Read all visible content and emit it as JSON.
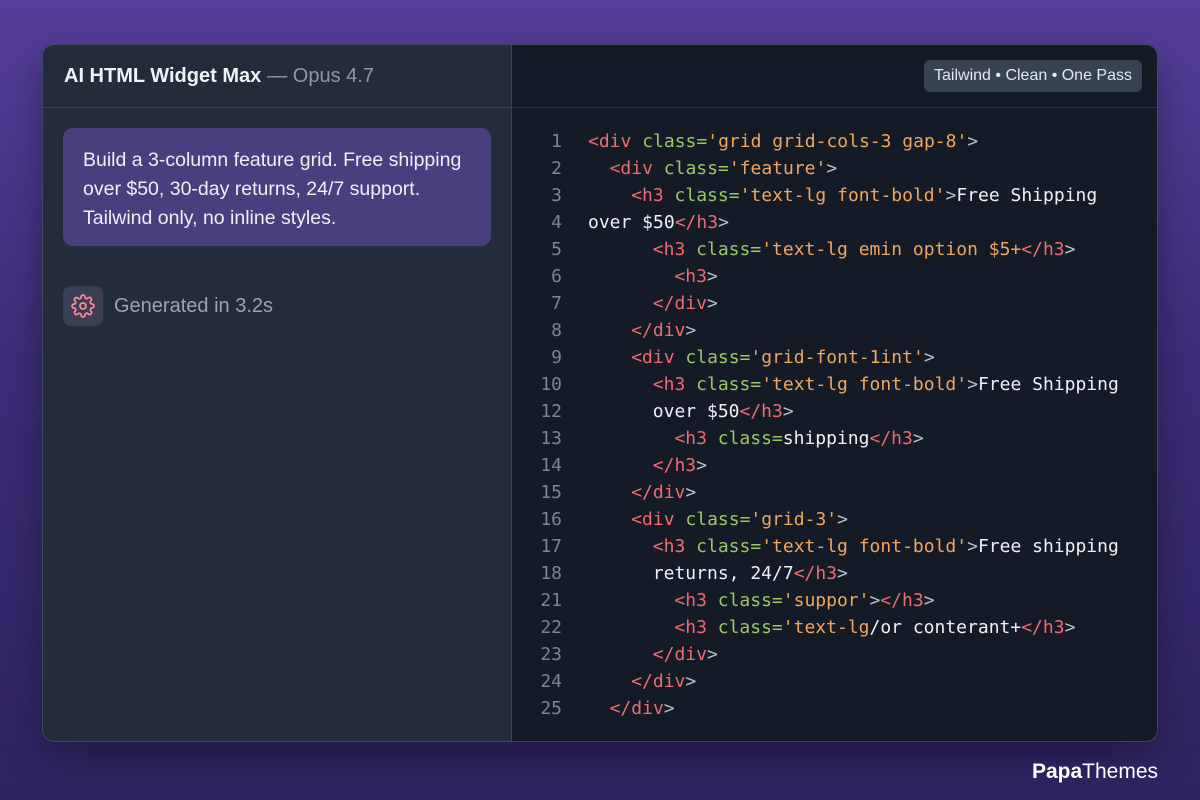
{
  "header": {
    "app_title": "AI HTML Widget Max",
    "model": "— Opus 4.7",
    "badge": "Tailwind • Clean • One Pass"
  },
  "prompt": {
    "text": "Build a 3-column feature grid. Free shipping over $50, 30-day returns, 24/7 support. Tailwind only, no inline styles."
  },
  "status": {
    "icon": "gear-icon",
    "text": "Generated in 3.2s"
  },
  "colors": {
    "tag": "#ef6b73",
    "attribute": "#99c966",
    "string": "#f0a65e",
    "accent_bubble": "#4a3f7e"
  },
  "code": {
    "lines": [
      {
        "n": "1",
        "indent": 0,
        "tokens": [
          [
            "tag",
            "<div"
          ],
          [
            "text",
            " "
          ],
          [
            "attr",
            "class="
          ],
          [
            "str",
            "'grid grid-cols-3 gap-8'"
          ],
          [
            "punc",
            ">"
          ]
        ]
      },
      {
        "n": "2",
        "indent": 1,
        "tokens": [
          [
            "tag",
            "<div"
          ],
          [
            "text",
            " "
          ],
          [
            "attr",
            "class="
          ],
          [
            "str",
            "'feature'"
          ],
          [
            "punc",
            ">"
          ]
        ]
      },
      {
        "n": "3",
        "indent": 2,
        "tokens": [
          [
            "tag",
            "<h3"
          ],
          [
            "text",
            " "
          ],
          [
            "attr",
            "class="
          ],
          [
            "str",
            "'text-lg font-bold'"
          ],
          [
            "punc",
            ">"
          ],
          [
            "text",
            "Free Shipping"
          ]
        ]
      },
      {
        "n": "4",
        "indent": 0,
        "tokens": [
          [
            "text",
            "over $50"
          ],
          [
            "tag",
            "</h3"
          ],
          [
            "punc",
            ">"
          ]
        ]
      },
      {
        "n": "5",
        "indent": 3,
        "tokens": [
          [
            "tag",
            "<h3"
          ],
          [
            "text",
            " "
          ],
          [
            "attr",
            "class="
          ],
          [
            "str",
            "'text-lg emin option $5+"
          ],
          [
            "tag",
            "</h3"
          ],
          [
            "punc",
            ">"
          ]
        ]
      },
      {
        "n": "6",
        "indent": 4,
        "tokens": [
          [
            "tag",
            "<h3"
          ],
          [
            "punc",
            ">"
          ]
        ]
      },
      {
        "n": "7",
        "indent": 3,
        "tokens": [
          [
            "tag",
            "</div"
          ],
          [
            "punc",
            ">"
          ]
        ]
      },
      {
        "n": "8",
        "indent": 2,
        "tokens": [
          [
            "tag",
            "</div"
          ],
          [
            "punc",
            ">"
          ]
        ]
      },
      {
        "n": "9",
        "indent": 2,
        "tokens": [
          [
            "tag",
            "<div"
          ],
          [
            "text",
            " "
          ],
          [
            "attr",
            "class="
          ],
          [
            "str",
            "'grid-font-1int'"
          ],
          [
            "punc",
            ">"
          ]
        ]
      },
      {
        "n": "10",
        "indent": 3,
        "tokens": [
          [
            "tag",
            "<h3"
          ],
          [
            "text",
            " "
          ],
          [
            "attr",
            "class="
          ],
          [
            "str",
            "'text-lg font-bold'"
          ],
          [
            "punc",
            ">"
          ],
          [
            "text",
            "Free Shipping"
          ]
        ]
      },
      {
        "n": "12",
        "indent": 3,
        "tokens": [
          [
            "text",
            "over $50"
          ],
          [
            "tag",
            "</h3"
          ],
          [
            "punc",
            ">"
          ]
        ]
      },
      {
        "n": "13",
        "indent": 4,
        "tokens": [
          [
            "tag",
            "<h3"
          ],
          [
            "text",
            " "
          ],
          [
            "attr",
            "class="
          ],
          [
            "text",
            "shipping"
          ],
          [
            "tag",
            "</h3"
          ],
          [
            "punc",
            ">"
          ]
        ]
      },
      {
        "n": "14",
        "indent": 3,
        "tokens": [
          [
            "tag",
            "</h3"
          ],
          [
            "punc",
            ">"
          ]
        ]
      },
      {
        "n": "15",
        "indent": 2,
        "tokens": [
          [
            "tag",
            "</div"
          ],
          [
            "punc",
            ">"
          ]
        ]
      },
      {
        "n": "16",
        "indent": 2,
        "tokens": [
          [
            "tag",
            "<div"
          ],
          [
            "text",
            " "
          ],
          [
            "attr",
            "class="
          ],
          [
            "str",
            "'grid-3'"
          ],
          [
            "punc",
            ">"
          ]
        ]
      },
      {
        "n": "17",
        "indent": 3,
        "tokens": [
          [
            "tag",
            "<h3"
          ],
          [
            "text",
            " "
          ],
          [
            "attr",
            "class="
          ],
          [
            "str",
            "'text-lg font-bold'"
          ],
          [
            "punc",
            ">"
          ],
          [
            "text",
            "Free shipping"
          ]
        ]
      },
      {
        "n": "18",
        "indent": 3,
        "tokens": [
          [
            "text",
            "returns, 24/7"
          ],
          [
            "tag",
            "</h3"
          ],
          [
            "punc",
            ">"
          ]
        ]
      },
      {
        "n": "21",
        "indent": 4,
        "tokens": [
          [
            "tag",
            "<h3"
          ],
          [
            "text",
            " "
          ],
          [
            "attr",
            "class="
          ],
          [
            "str",
            "'suppor'"
          ],
          [
            "punc",
            ">"
          ],
          [
            "tag",
            "</h3"
          ],
          [
            "punc",
            ">"
          ]
        ]
      },
      {
        "n": "22",
        "indent": 4,
        "tokens": [
          [
            "tag",
            "<h3"
          ],
          [
            "text",
            " "
          ],
          [
            "attr",
            "class="
          ],
          [
            "str",
            "'text-lg"
          ],
          [
            "text",
            "/or conterant+"
          ],
          [
            "tag",
            "</h3"
          ],
          [
            "punc",
            ">"
          ]
        ]
      },
      {
        "n": "23",
        "indent": 3,
        "tokens": [
          [
            "tag",
            "</div"
          ],
          [
            "punc",
            ">"
          ]
        ]
      },
      {
        "n": "24",
        "indent": 2,
        "tokens": [
          [
            "tag",
            "</div"
          ],
          [
            "punc",
            ">"
          ]
        ]
      },
      {
        "n": "25",
        "indent": 1,
        "tokens": [
          [
            "tag",
            "</div"
          ],
          [
            "punc",
            ">"
          ]
        ]
      }
    ]
  },
  "brand": {
    "part1": "Papa",
    "part2": "Themes"
  }
}
